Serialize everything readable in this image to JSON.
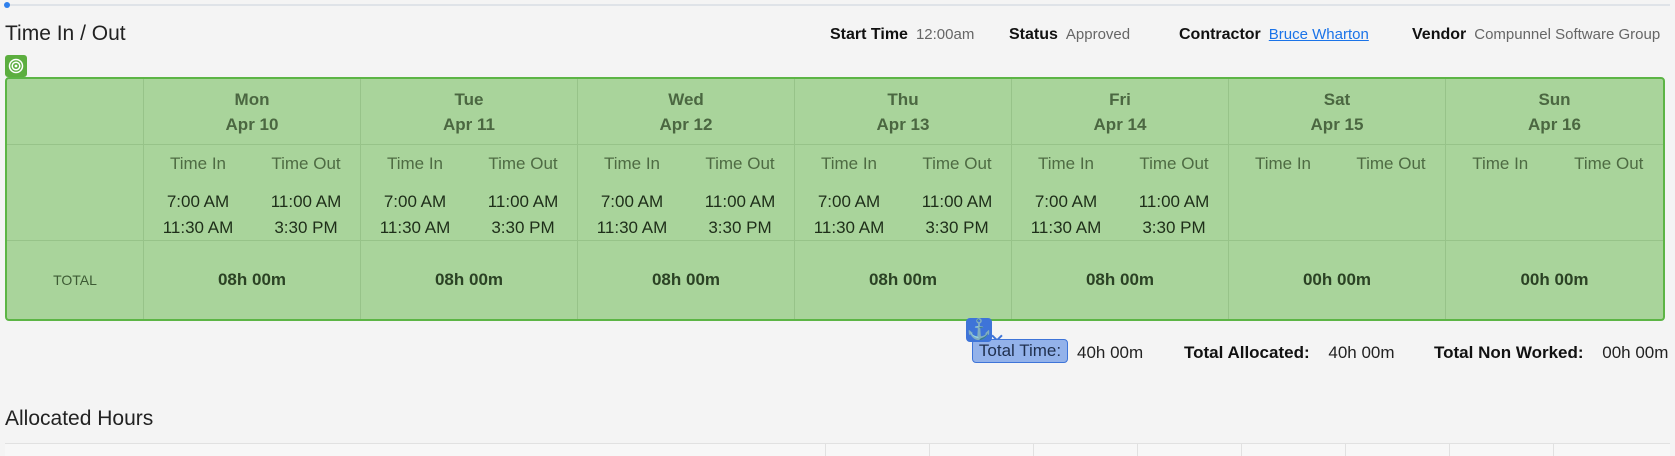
{
  "header": {
    "title": "Time In / Out",
    "start_time_label": "Start Time",
    "start_time_value": "12:00am",
    "status_label": "Status",
    "status_value": "Approved",
    "contractor_label": "Contractor",
    "contractor_value": "Bruce Wharton",
    "vendor_label": "Vendor",
    "vendor_value": "Compunnel Software Group"
  },
  "grid": {
    "time_in_label": "Time In",
    "time_out_label": "Time Out",
    "total_label": "TOTAL",
    "days": [
      {
        "day": "Mon",
        "date": "Apr 10",
        "in1": "7:00 AM",
        "out1": "11:00 AM",
        "in2": "11:30 AM",
        "out2": "3:30 PM",
        "total": "08h 00m"
      },
      {
        "day": "Tue",
        "date": "Apr 11",
        "in1": "7:00 AM",
        "out1": "11:00 AM",
        "in2": "11:30 AM",
        "out2": "3:30 PM",
        "total": "08h 00m"
      },
      {
        "day": "Wed",
        "date": "Apr 12",
        "in1": "7:00 AM",
        "out1": "11:00 AM",
        "in2": "11:30 AM",
        "out2": "3:30 PM",
        "total": "08h 00m"
      },
      {
        "day": "Thu",
        "date": "Apr 13",
        "in1": "7:00 AM",
        "out1": "11:00 AM",
        "in2": "11:30 AM",
        "out2": "3:30 PM",
        "total": "08h 00m"
      },
      {
        "day": "Fri",
        "date": "Apr 14",
        "in1": "7:00 AM",
        "out1": "11:00 AM",
        "in2": "11:30 AM",
        "out2": "3:30 PM",
        "total": "08h 00m"
      },
      {
        "day": "Sat",
        "date": "Apr 15",
        "in1": "",
        "out1": "",
        "in2": "",
        "out2": "",
        "total": "00h 00m"
      },
      {
        "day": "Sun",
        "date": "Apr 16",
        "in1": "",
        "out1": "",
        "in2": "",
        "out2": "",
        "total": "00h 00m"
      }
    ]
  },
  "totals": {
    "total_time_label": "Total Time:",
    "total_time_value": "40h 00m",
    "total_allocated_label": "Total Allocated:",
    "total_allocated_value": "40h 00m",
    "total_non_worked_label": "Total Non Worked:",
    "total_non_worked_value": "00h 00m"
  },
  "allocated": {
    "title": "Allocated Hours"
  },
  "icons": {
    "target": "target-icon",
    "anchor": "anchor-icon"
  },
  "colors": {
    "grid_bg": "#a9d49b",
    "grid_border": "#5cb545",
    "link": "#1a73e8",
    "selection": "#3e74d8"
  }
}
